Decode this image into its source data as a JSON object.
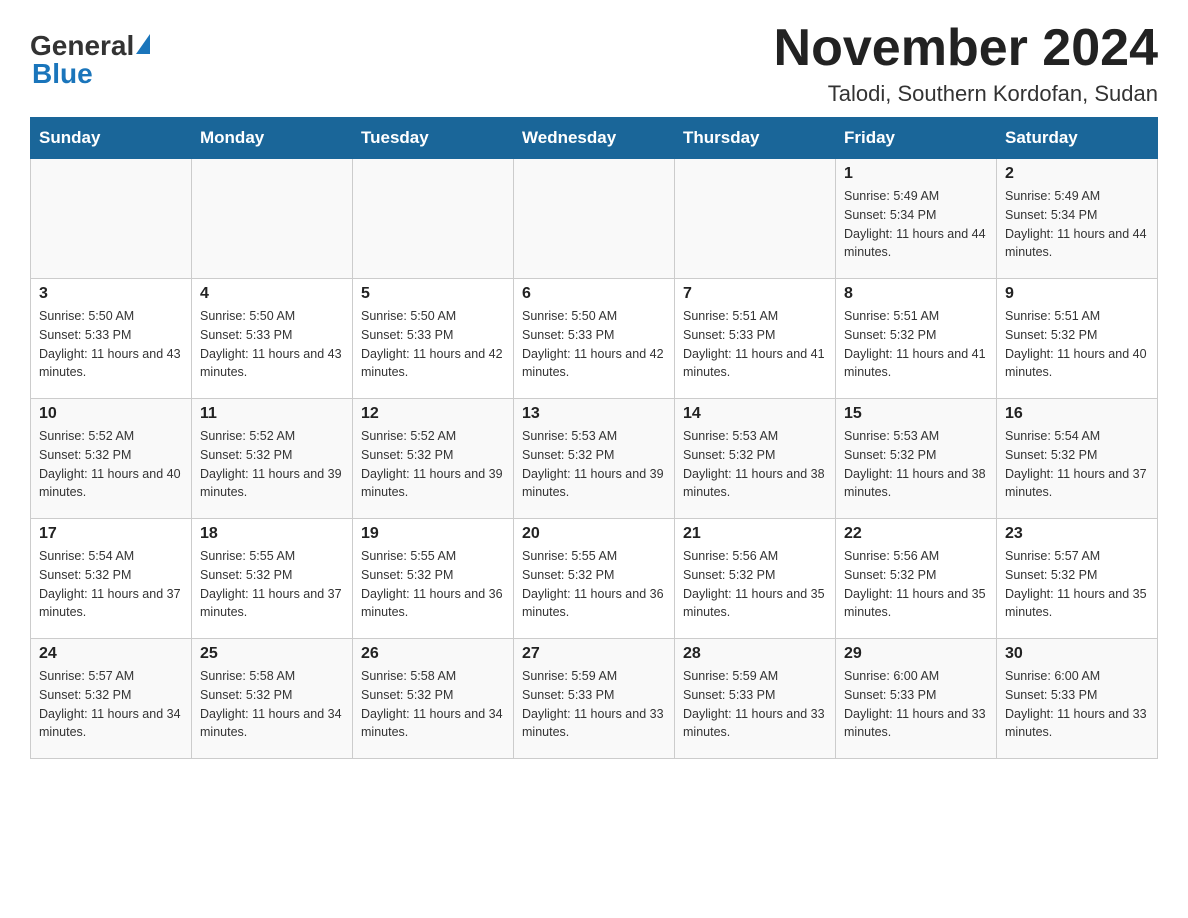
{
  "header": {
    "logo_general": "General",
    "logo_blue": "Blue",
    "month_title": "November 2024",
    "location": "Talodi, Southern Kordofan, Sudan"
  },
  "days_of_week": [
    "Sunday",
    "Monday",
    "Tuesday",
    "Wednesday",
    "Thursday",
    "Friday",
    "Saturday"
  ],
  "weeks": [
    [
      {
        "day": "",
        "info": ""
      },
      {
        "day": "",
        "info": ""
      },
      {
        "day": "",
        "info": ""
      },
      {
        "day": "",
        "info": ""
      },
      {
        "day": "",
        "info": ""
      },
      {
        "day": "1",
        "info": "Sunrise: 5:49 AM\nSunset: 5:34 PM\nDaylight: 11 hours and 44 minutes."
      },
      {
        "day": "2",
        "info": "Sunrise: 5:49 AM\nSunset: 5:34 PM\nDaylight: 11 hours and 44 minutes."
      }
    ],
    [
      {
        "day": "3",
        "info": "Sunrise: 5:50 AM\nSunset: 5:33 PM\nDaylight: 11 hours and 43 minutes."
      },
      {
        "day": "4",
        "info": "Sunrise: 5:50 AM\nSunset: 5:33 PM\nDaylight: 11 hours and 43 minutes."
      },
      {
        "day": "5",
        "info": "Sunrise: 5:50 AM\nSunset: 5:33 PM\nDaylight: 11 hours and 42 minutes."
      },
      {
        "day": "6",
        "info": "Sunrise: 5:50 AM\nSunset: 5:33 PM\nDaylight: 11 hours and 42 minutes."
      },
      {
        "day": "7",
        "info": "Sunrise: 5:51 AM\nSunset: 5:33 PM\nDaylight: 11 hours and 41 minutes."
      },
      {
        "day": "8",
        "info": "Sunrise: 5:51 AM\nSunset: 5:32 PM\nDaylight: 11 hours and 41 minutes."
      },
      {
        "day": "9",
        "info": "Sunrise: 5:51 AM\nSunset: 5:32 PM\nDaylight: 11 hours and 40 minutes."
      }
    ],
    [
      {
        "day": "10",
        "info": "Sunrise: 5:52 AM\nSunset: 5:32 PM\nDaylight: 11 hours and 40 minutes."
      },
      {
        "day": "11",
        "info": "Sunrise: 5:52 AM\nSunset: 5:32 PM\nDaylight: 11 hours and 39 minutes."
      },
      {
        "day": "12",
        "info": "Sunrise: 5:52 AM\nSunset: 5:32 PM\nDaylight: 11 hours and 39 minutes."
      },
      {
        "day": "13",
        "info": "Sunrise: 5:53 AM\nSunset: 5:32 PM\nDaylight: 11 hours and 39 minutes."
      },
      {
        "day": "14",
        "info": "Sunrise: 5:53 AM\nSunset: 5:32 PM\nDaylight: 11 hours and 38 minutes."
      },
      {
        "day": "15",
        "info": "Sunrise: 5:53 AM\nSunset: 5:32 PM\nDaylight: 11 hours and 38 minutes."
      },
      {
        "day": "16",
        "info": "Sunrise: 5:54 AM\nSunset: 5:32 PM\nDaylight: 11 hours and 37 minutes."
      }
    ],
    [
      {
        "day": "17",
        "info": "Sunrise: 5:54 AM\nSunset: 5:32 PM\nDaylight: 11 hours and 37 minutes."
      },
      {
        "day": "18",
        "info": "Sunrise: 5:55 AM\nSunset: 5:32 PM\nDaylight: 11 hours and 37 minutes."
      },
      {
        "day": "19",
        "info": "Sunrise: 5:55 AM\nSunset: 5:32 PM\nDaylight: 11 hours and 36 minutes."
      },
      {
        "day": "20",
        "info": "Sunrise: 5:55 AM\nSunset: 5:32 PM\nDaylight: 11 hours and 36 minutes."
      },
      {
        "day": "21",
        "info": "Sunrise: 5:56 AM\nSunset: 5:32 PM\nDaylight: 11 hours and 35 minutes."
      },
      {
        "day": "22",
        "info": "Sunrise: 5:56 AM\nSunset: 5:32 PM\nDaylight: 11 hours and 35 minutes."
      },
      {
        "day": "23",
        "info": "Sunrise: 5:57 AM\nSunset: 5:32 PM\nDaylight: 11 hours and 35 minutes."
      }
    ],
    [
      {
        "day": "24",
        "info": "Sunrise: 5:57 AM\nSunset: 5:32 PM\nDaylight: 11 hours and 34 minutes."
      },
      {
        "day": "25",
        "info": "Sunrise: 5:58 AM\nSunset: 5:32 PM\nDaylight: 11 hours and 34 minutes."
      },
      {
        "day": "26",
        "info": "Sunrise: 5:58 AM\nSunset: 5:32 PM\nDaylight: 11 hours and 34 minutes."
      },
      {
        "day": "27",
        "info": "Sunrise: 5:59 AM\nSunset: 5:33 PM\nDaylight: 11 hours and 33 minutes."
      },
      {
        "day": "28",
        "info": "Sunrise: 5:59 AM\nSunset: 5:33 PM\nDaylight: 11 hours and 33 minutes."
      },
      {
        "day": "29",
        "info": "Sunrise: 6:00 AM\nSunset: 5:33 PM\nDaylight: 11 hours and 33 minutes."
      },
      {
        "day": "30",
        "info": "Sunrise: 6:00 AM\nSunset: 5:33 PM\nDaylight: 11 hours and 33 minutes."
      }
    ]
  ]
}
